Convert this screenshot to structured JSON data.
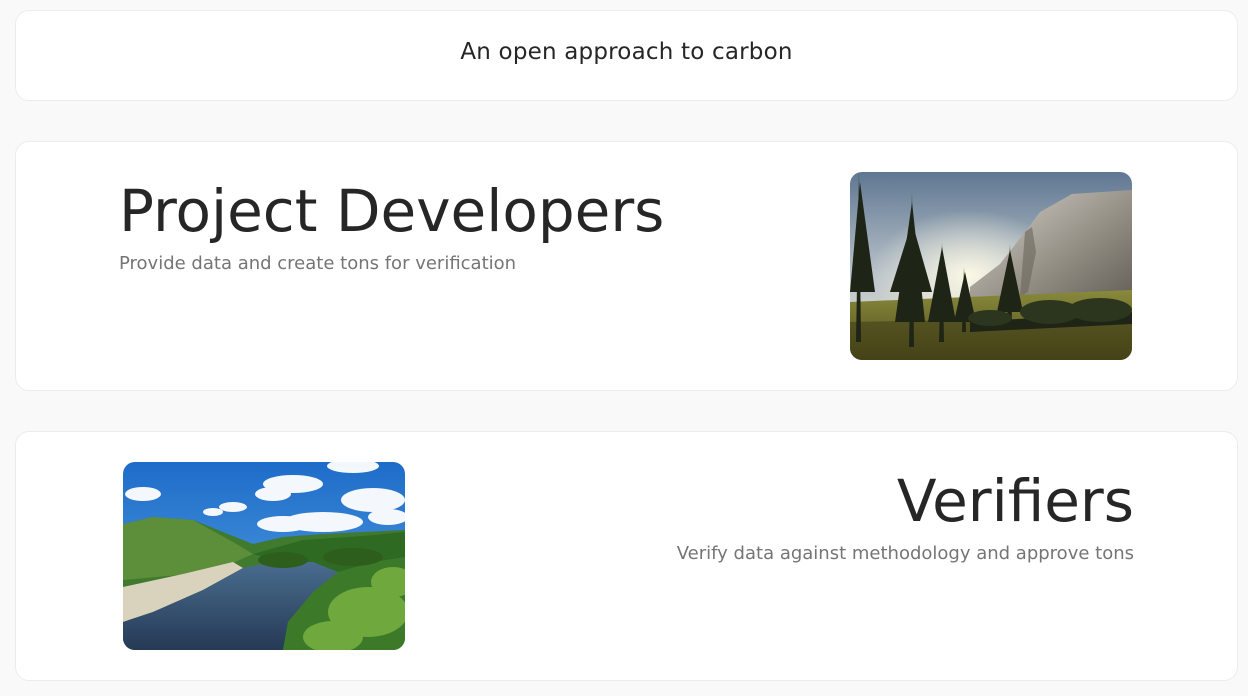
{
  "header": {
    "title": "An open approach to carbon"
  },
  "sections": [
    {
      "title": "Project Developers",
      "subtitle": "Provide data and create tons for verification",
      "image": "forest-cliff-photo"
    },
    {
      "title": "Verifiers",
      "subtitle": "Verify data against methodology and approve tons",
      "image": "river-valley-photo"
    }
  ],
  "colors": {
    "page_background": "#f9f9f9",
    "card_background": "#ffffff",
    "title_text": "#262626",
    "subtitle_text": "#757575"
  }
}
